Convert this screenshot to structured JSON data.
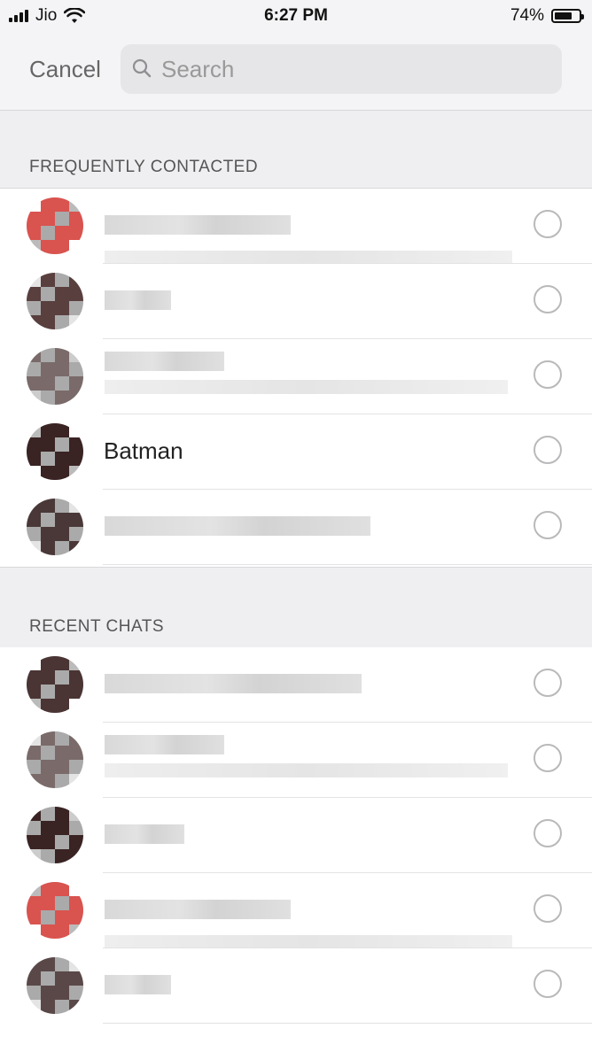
{
  "status_bar": {
    "carrier": "Jio",
    "time": "6:27 PM",
    "battery_percent": "74%",
    "battery_level": 0.74
  },
  "nav": {
    "cancel_label": "Cancel",
    "search_placeholder": "Search"
  },
  "sections": {
    "frequent": {
      "title": "FREQUENTLY CONTACTED",
      "rows": [
        {
          "name": "",
          "avatar_color": "#d9534f"
        },
        {
          "name": "",
          "avatar_color": "#5a3f3f"
        },
        {
          "name": "",
          "avatar_color": "#7a6a6a"
        },
        {
          "name": "Batman",
          "avatar_color": "#3a2323"
        },
        {
          "name": "",
          "avatar_color": "#4a3838"
        }
      ]
    },
    "recent": {
      "title": "RECENT CHATS",
      "rows": [
        {
          "name": "",
          "avatar_color": "#4a3434"
        },
        {
          "name": "",
          "avatar_color": "#7a6a6a"
        },
        {
          "name": "",
          "avatar_color": "#3a2323"
        },
        {
          "name": "",
          "avatar_color": "#d9534f"
        },
        {
          "name": "",
          "avatar_color": "#5a4848"
        }
      ]
    }
  },
  "colors": {
    "background": "#ffffff",
    "header_bg": "#efeff2",
    "search_bg": "#e6e6e8",
    "radio_border": "#b9b9bb",
    "text_muted": "#666666"
  }
}
